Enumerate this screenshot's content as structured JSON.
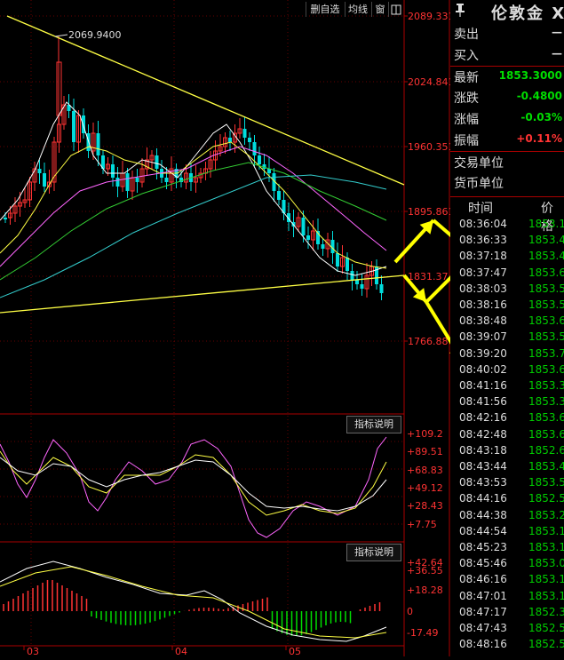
{
  "toolbar": {
    "btn_favorite": "删自选",
    "btn_ma": "均线",
    "btn_window": "窗"
  },
  "price_axis": [
    "2089.331",
    "2024.841",
    "1960.351",
    "1895.861",
    "1831.37",
    "1766.88"
  ],
  "high_marker": "2069.9400",
  "indicator1": {
    "button": "指标说明",
    "axis": [
      "+109.2",
      "+89.51",
      "+68.83",
      "+49.12",
      "+28.43",
      "+7.75"
    ]
  },
  "indicator2": {
    "button": "指标说明",
    "axis": [
      "+42.64",
      "+36.55",
      "+18.28",
      "0",
      "-17.49"
    ]
  },
  "date_axis": [
    "03",
    "04",
    "05"
  ],
  "quote": {
    "title": "伦敦金 X",
    "rows": [
      {
        "label": "卖出",
        "value": "—",
        "color": "#ddd"
      },
      {
        "label": "买入",
        "value": "—",
        "color": "#ddd"
      },
      {
        "label": "最新",
        "value": "1853.3000",
        "color": "#00dd00"
      },
      {
        "label": "涨跌",
        "value": "-0.4800",
        "color": "#00dd00"
      },
      {
        "label": "涨幅",
        "value": "-0.03%",
        "color": "#00dd00"
      },
      {
        "label": "振幅",
        "value": "+0.11%",
        "color": "#ff3333"
      },
      {
        "label": "交易单位",
        "value": "",
        "color": "#ddd"
      },
      {
        "label": "货币单位",
        "value": "",
        "color": "#ddd"
      }
    ]
  },
  "ticks_header": {
    "time": "时间",
    "price": "价格"
  },
  "ticks": [
    {
      "time": "08:36:04",
      "price": "1853.1"
    },
    {
      "time": "08:36:33",
      "price": "1853.4"
    },
    {
      "time": "08:37:18",
      "price": "1853.4"
    },
    {
      "time": "08:37:47",
      "price": "1853.6"
    },
    {
      "time": "08:38:03",
      "price": "1853.5"
    },
    {
      "time": "08:38:16",
      "price": "1853.5"
    },
    {
      "time": "08:38:48",
      "price": "1853.6"
    },
    {
      "time": "08:39:07",
      "price": "1853.5"
    },
    {
      "time": "08:39:20",
      "price": "1853.7"
    },
    {
      "time": "08:40:02",
      "price": "1853.6"
    },
    {
      "time": "08:41:16",
      "price": "1853.3"
    },
    {
      "time": "08:41:56",
      "price": "1853.3"
    },
    {
      "time": "08:42:16",
      "price": "1853.6"
    },
    {
      "time": "08:42:48",
      "price": "1853.6"
    },
    {
      "time": "08:43:18",
      "price": "1852.6"
    },
    {
      "time": "08:43:44",
      "price": "1853.4"
    },
    {
      "time": "08:43:53",
      "price": "1853.5"
    },
    {
      "time": "08:44:16",
      "price": "1852.5"
    },
    {
      "time": "08:44:38",
      "price": "1853.2"
    },
    {
      "time": "08:44:54",
      "price": "1853.1"
    },
    {
      "time": "08:45:23",
      "price": "1853.1"
    },
    {
      "time": "08:45:46",
      "price": "1853.0"
    },
    {
      "time": "08:46:16",
      "price": "1853.1"
    },
    {
      "time": "08:47:01",
      "price": "1853.1"
    },
    {
      "time": "08:47:17",
      "price": "1852.3"
    },
    {
      "time": "08:47:43",
      "price": "1852.5"
    },
    {
      "time": "08:48:16",
      "price": "1852.5"
    }
  ],
  "colors": {
    "up": "#ff3333",
    "down": "#00dddd",
    "trend": "#ffff44",
    "arrow": "#ffff00"
  }
}
